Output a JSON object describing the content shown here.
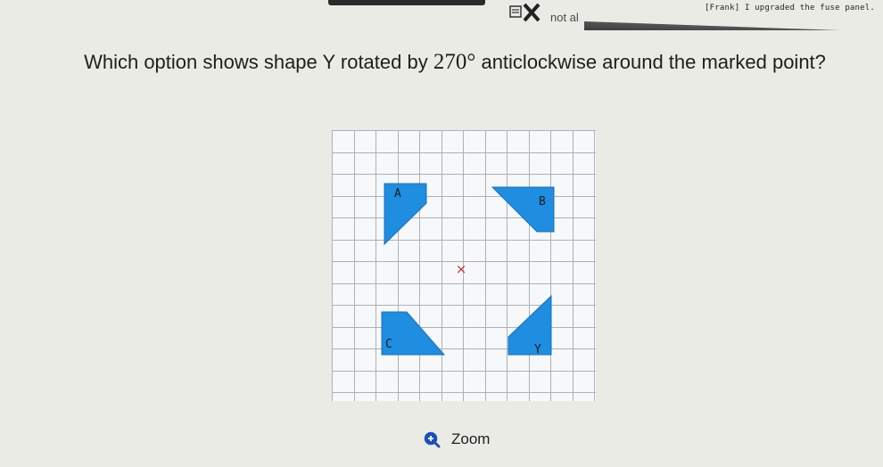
{
  "top_bar": {
    "caption": "not al",
    "note": "[Frank] I upgraded the fuse panel."
  },
  "question": {
    "prefix": "Which option shows shape Y rotated by ",
    "angle": "270°",
    "suffix": " anticlockwise around the marked point?"
  },
  "grid": {
    "marker": "×",
    "labels": {
      "A": "A",
      "B": "B",
      "C": "C",
      "Y": "Y"
    },
    "colors": {
      "shape_fill": "#1f8de0",
      "shape_stroke": "#1a6fc0",
      "grid_line": "#a9b2bb",
      "marker": "#c8323a"
    }
  },
  "zoom": {
    "label": "Zoom",
    "icon": "zoom-in-icon"
  }
}
